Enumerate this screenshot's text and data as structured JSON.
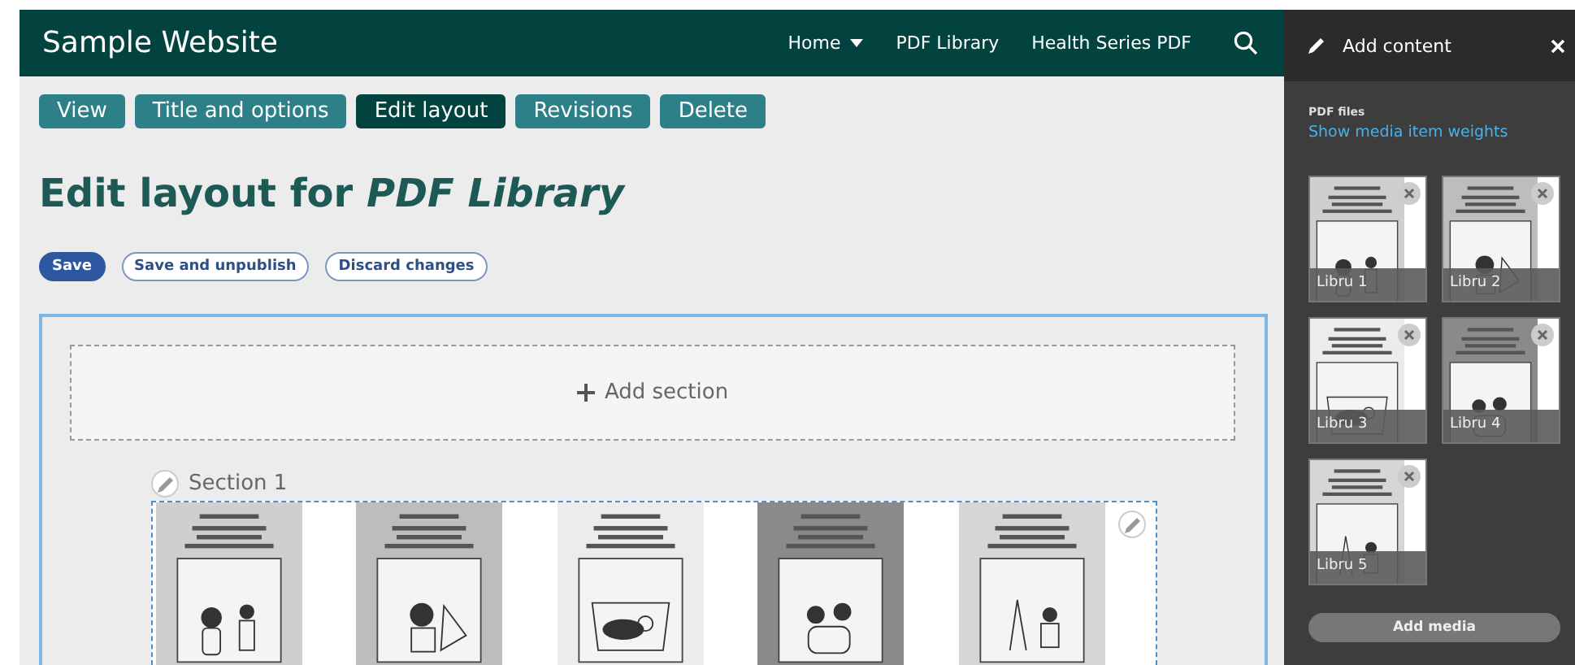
{
  "site": {
    "title": "Sample Website",
    "nav": [
      {
        "label": "Home",
        "dropdown": true
      },
      {
        "label": "PDF Library",
        "dropdown": false
      },
      {
        "label": "Health Series PDF",
        "dropdown": false
      }
    ]
  },
  "tabs": [
    {
      "label": "View",
      "selected": false
    },
    {
      "label": "Title and options",
      "selected": false
    },
    {
      "label": "Edit layout",
      "selected": true
    },
    {
      "label": "Revisions",
      "selected": false
    },
    {
      "label": "Delete",
      "selected": false
    }
  ],
  "heading": "Edit layout for *PDF Library*",
  "actions": [
    {
      "label": "Save",
      "kind": "primary"
    },
    {
      "label": "Save and unpublish",
      "kind": "outline"
    },
    {
      "label": "Discard changes",
      "kind": "outline"
    }
  ],
  "layout": {
    "add_section": "Add section",
    "section": {
      "title": "Section 1"
    }
  },
  "sidebar": {
    "title": "Add content",
    "group_label": "PDF files",
    "link": "Show media item weights",
    "media": [
      {
        "label": "Libru 1"
      },
      {
        "label": "Libru 2"
      },
      {
        "label": "Libru 3"
      },
      {
        "label": "Libru 4"
      },
      {
        "label": "Libru 5"
      }
    ],
    "add_button": "Add media"
  }
}
